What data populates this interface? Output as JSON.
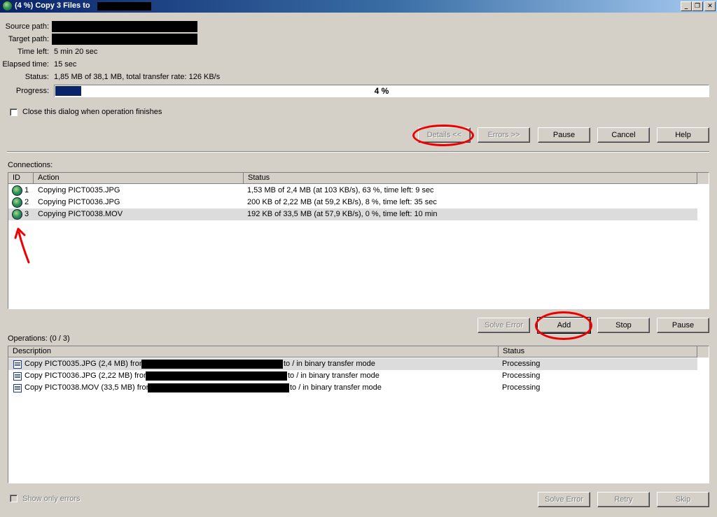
{
  "window": {
    "title": "(4 %) Copy 3 Files to",
    "buttons": {
      "minimize": "_",
      "restore": "❐",
      "close": "✕"
    }
  },
  "info": {
    "source_label": "Source path:",
    "target_label": "Target path:",
    "time_left_label": "Time left:",
    "time_left_value": "5 min 20 sec",
    "elapsed_label": "Elapsed time:",
    "elapsed_value": "15 sec",
    "status_label": "Status:",
    "status_value": "1,85 MB of 38,1 MB, total transfer rate: 126 KB/s",
    "progress_label": "Progress:",
    "progress_text": "4 %",
    "progress_fraction": 0.04
  },
  "close_dialog_label": "Close this dialog when operation finishes",
  "top_buttons": {
    "details": "Details <<",
    "errors": "Errors >>",
    "pause": "Pause",
    "cancel": "Cancel",
    "help": "Help"
  },
  "connections": {
    "label": "Connections:",
    "columns": [
      "ID",
      "Action",
      "Status"
    ],
    "rows": [
      {
        "id": "1",
        "action": "Copying PICT0035.JPG",
        "status": "1,53 MB of 2,4 MB (at 103 KB/s), 63 %, time left: 9 sec"
      },
      {
        "id": "2",
        "action": "Copying PICT0036.JPG",
        "status": "200 KB of 2,22 MB (at 59,2 KB/s), 8 %, time left: 35 sec"
      },
      {
        "id": "3",
        "action": "Copying PICT0038.MOV",
        "status": "192 KB of 33,5 MB (at 57,9 KB/s), 0 %, time left: 10 min"
      }
    ]
  },
  "mid_buttons": {
    "solve_error": "Solve Error",
    "add": "Add",
    "stop": "Stop",
    "pause": "Pause"
  },
  "operations": {
    "label": "Operations: (0 / 3)",
    "columns": [
      "Description",
      "Status"
    ],
    "rows": [
      {
        "pre": "Copy PICT0035.JPG (2,4 MB) from",
        "post": "to / in binary transfer mode",
        "status": "Processing"
      },
      {
        "pre": "Copy PICT0036.JPG (2,22 MB) from",
        "post": "to / in binary transfer mode",
        "status": "Processing"
      },
      {
        "pre": "Copy PICT0038.MOV (33,5 MB) from",
        "post": "to / in binary transfer mode",
        "status": "Processing"
      }
    ]
  },
  "bottom": {
    "show_only_errors": "Show only errors",
    "solve_error": "Solve Error",
    "retry": "Retry",
    "skip": "Skip"
  },
  "colors": {
    "annotation": "#ee0000",
    "progress_fill": "#0a246a"
  }
}
